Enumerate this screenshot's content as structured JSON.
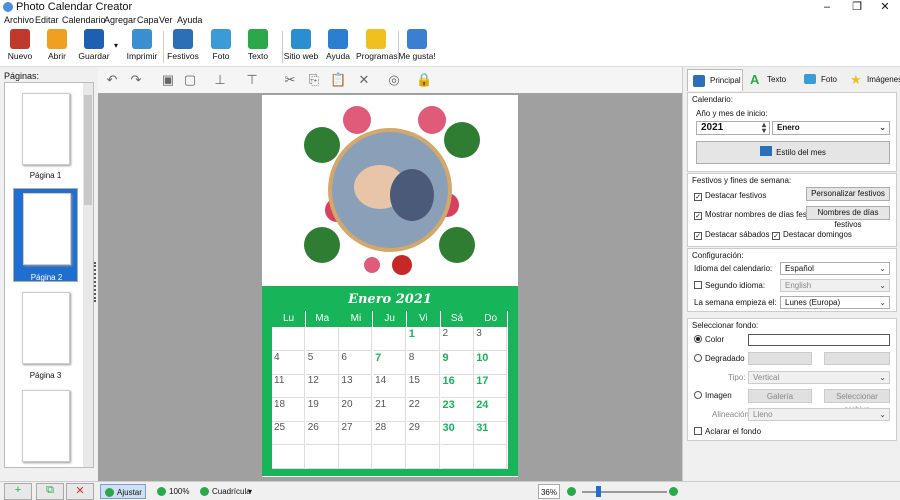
{
  "window": {
    "title": "Photo Calendar Creator"
  },
  "menu": [
    "Archivo",
    "Editar",
    "Calendario",
    "Agregar",
    "Capa",
    "Ver",
    "Ayuda"
  ],
  "toolbar": [
    {
      "label": "Nuevo",
      "icon": "new-icon",
      "color": "#c0392b"
    },
    {
      "label": "Abrir",
      "icon": "open-folder-icon",
      "color": "#f0a020"
    },
    {
      "label": "Guardar",
      "icon": "save-icon",
      "color": "#1e5fb4"
    },
    {
      "label": "Imprimir",
      "icon": "print-icon",
      "color": "#3a8fd0"
    },
    {
      "label": "Festivos",
      "icon": "holidays-icon",
      "color": "#2a6fb8"
    },
    {
      "label": "Foto",
      "icon": "photo-icon",
      "color": "#3a9bd8"
    },
    {
      "label": "Texto",
      "icon": "text-icon",
      "color": "#2aa84a"
    },
    {
      "label": "Sitio web",
      "icon": "website-icon",
      "color": "#2a8fd0"
    },
    {
      "label": "Ayuda",
      "icon": "help-book-icon",
      "color": "#2a7fd0"
    },
    {
      "label": "Programas",
      "icon": "programs-icon",
      "color": "#f0c020"
    },
    {
      "label": "Me gusta!",
      "icon": "like-icon",
      "color": "#3a7fd0"
    }
  ],
  "pages": {
    "label": "Páginas:",
    "items": [
      {
        "caption": "Página 1",
        "selected": false
      },
      {
        "caption": "Página 2",
        "selected": true
      },
      {
        "caption": "Página 3",
        "selected": false
      },
      {
        "caption": "",
        "selected": false
      }
    ]
  },
  "calendar": {
    "title": "Enero 2021",
    "weekdays": [
      "Lu",
      "Ma",
      "Mi",
      "Ju",
      "Vi",
      "Sá",
      "Do"
    ],
    "rows": [
      [
        "",
        "",
        "",
        "",
        "1",
        "2",
        "3"
      ],
      [
        "4",
        "5",
        "6",
        "7",
        "8",
        "9",
        "10"
      ],
      [
        "11",
        "12",
        "13",
        "14",
        "15",
        "16",
        "17"
      ],
      [
        "18",
        "19",
        "20",
        "21",
        "22",
        "23",
        "24"
      ],
      [
        "25",
        "26",
        "27",
        "28",
        "29",
        "30",
        "31"
      ],
      [
        "",
        "",
        "",
        "",
        "",
        "",
        ""
      ]
    ],
    "holidays": [
      "1",
      "7",
      "9",
      "10",
      "16",
      "17",
      "23",
      "24",
      "30",
      "31"
    ]
  },
  "status": {
    "fit": "Ajustar",
    "zoom100": "100%",
    "grid": "Cuadrícula",
    "zoom": "36%"
  },
  "right": {
    "tabs": [
      "Principal",
      "Texto",
      "Foto",
      "Imágenes"
    ],
    "calendar_group": "Calendario:",
    "year_month_label": "Año y mes de inicio:",
    "year": "2021",
    "month": "Enero",
    "month_style": "Estilo del mes",
    "holidays_group": "Festivos y fines de semana:",
    "highlight_holidays": "Destacar festivos",
    "customize_holidays": "Personalizar festivos",
    "show_holiday_names": "Mostrar nombres de días festivos",
    "holiday_names_btn": "Nombres de días festivos",
    "highlight_saturdays": "Destacar sábados",
    "highlight_sundays": "Destacar domingos",
    "config_group": "Configuración:",
    "calendar_language_label": "Idioma del calendario:",
    "calendar_language": "Español",
    "second_language_label": "Segundo idioma:",
    "second_language": "English",
    "week_start_label": "La semana empieza el:",
    "week_start": "Lunes (Europa)",
    "bg_group": "Seleccionar fondo:",
    "bg_color": "Color",
    "bg_gradient": "Degradado",
    "type_label": "Tipo:",
    "type_value": "Vertical",
    "bg_image": "Imagen",
    "gallery": "Galería",
    "select_file": "Seleccionar archivo",
    "align_label": "Alineación:",
    "align_value": "Lleno",
    "lighten_bg": "Aclarar el fondo"
  }
}
